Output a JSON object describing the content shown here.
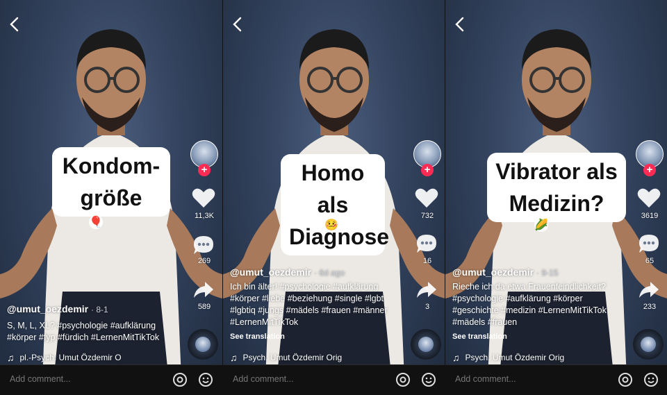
{
  "panels": [
    {
      "card_lines": [
        "Kondom-",
        "größe"
      ],
      "card_emoji": "🎈",
      "likes": "11,3K",
      "comments": "269",
      "shares": "589",
      "handle": "@umut_oezdemir",
      "date": "· 8-1",
      "caption": "S, M, L, XL? #psychologie #aufklärung #körper #fyp #fürdich #LernenMitTikTok",
      "see_translation": "",
      "music": "pl.-Psych. Umut Özdemir O",
      "comment_placeholder": "Add comment..."
    },
    {
      "card_lines": [
        "Homo als",
        "Diagnose"
      ],
      "card_emoji": "🤒",
      "likes": "732",
      "comments": "16",
      "shares": "3",
      "handle": "@umut_oezdemir",
      "date": "· 6d ago",
      "caption": "Ich bin älter! #psychologie #aufklärung #körper #liebe #beziehung #single #lgbt #lgbtiq #jungs #mädels #frauen #männer #LernenMitTikTok",
      "see_translation": "See translation",
      "music": "Psych. Umut Özdemir Orig",
      "comment_placeholder": "Add comment..."
    },
    {
      "card_lines": [
        "Vibrator als",
        "Medizin?"
      ],
      "card_emoji": "🌽",
      "likes": "3619",
      "comments": "65",
      "shares": "233",
      "handle": "@umut_oezdemir",
      "date": "· 9-15",
      "caption": "Rieche ich da etwa Frauenfeindlichkeit? #psychologie #aufklärung #körper #geschichte #medizin #LernenMitTikTok #mädels #frauen",
      "see_translation": "See translation",
      "music": "Psych. Umut Özdemir Orig",
      "comment_placeholder": "Add comment..."
    }
  ],
  "icons": {
    "back": "chevron-left-icon",
    "like": "heart-icon",
    "comment": "comment-bubble-icon",
    "share": "share-arrow-icon",
    "music": "music-note-icon",
    "mention": "at-sign-icon",
    "emoji": "emoji-smile-icon"
  },
  "colors": {
    "accent": "#fe2c55",
    "bar": "#111111"
  }
}
